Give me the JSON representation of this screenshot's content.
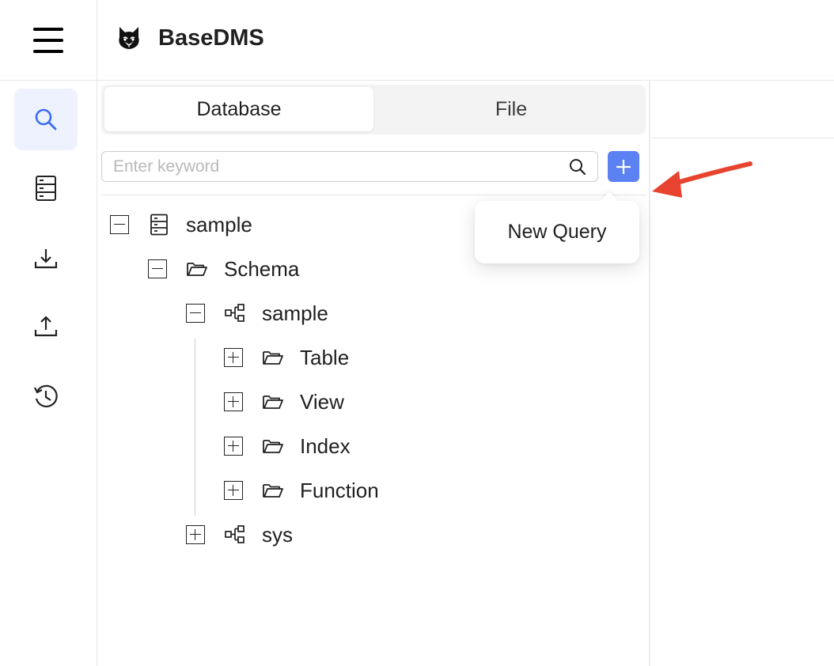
{
  "app": {
    "title": "BaseDMS"
  },
  "sidebar": {
    "items": [
      {
        "name": "search",
        "icon": "search-icon",
        "active": true
      },
      {
        "name": "database",
        "icon": "server-icon",
        "active": false
      },
      {
        "name": "import",
        "icon": "download-icon",
        "active": false
      },
      {
        "name": "export",
        "icon": "upload-icon",
        "active": false
      },
      {
        "name": "history",
        "icon": "history-icon",
        "active": false
      }
    ]
  },
  "tabs": [
    {
      "label": "Database",
      "active": true
    },
    {
      "label": "File",
      "active": false
    }
  ],
  "search": {
    "placeholder": "Enter keyword",
    "value": ""
  },
  "tree": {
    "connection": "sample",
    "schema_group": "Schema",
    "schemas": [
      {
        "label": "sample",
        "expanded": true,
        "children": [
          "Table",
          "View",
          "Index",
          "Function"
        ]
      },
      {
        "label": "sys",
        "expanded": false
      }
    ]
  },
  "popover": {
    "label": "New Query"
  },
  "colors": {
    "accent": "#5b81f2",
    "active_bg": "#eef2fe",
    "annotation": "#e8432e"
  }
}
